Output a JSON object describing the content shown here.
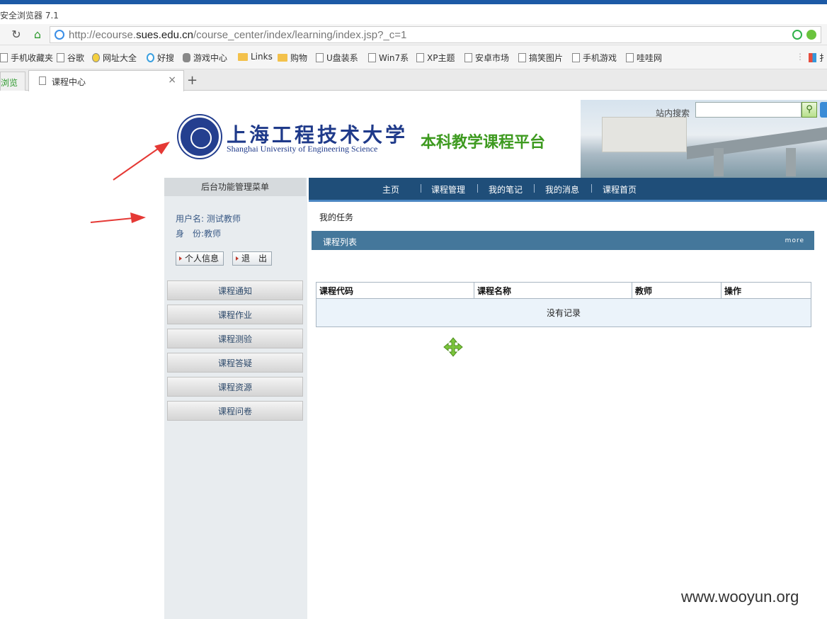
{
  "browser": {
    "window_title": "安全浏览器 7.1",
    "url_prefix": "http://ecourse.",
    "url_domain": "sues.edu.cn",
    "url_path": "/course_center/index/learning/index.jsp?_c=1",
    "bookmarks": [
      "手机收藏夹",
      "谷歌",
      "网址大全",
      "好搜",
      "游戏中心",
      "Links",
      "购物",
      "U盘装系",
      "Win7系",
      "XP主题",
      "安卓市场",
      "搞笑图片",
      "手机游戏",
      "哇哇网"
    ],
    "bookmark_overflow": "扌",
    "tab_left": "浏览",
    "tab_active": "课程中心",
    "tab_close": "×",
    "tab_new": "+"
  },
  "header": {
    "university_cn": "上海工程技术大学",
    "university_en": "Shanghai University of Engineering Science",
    "platform": "本科教学课程平台",
    "search_label": "站内搜索",
    "search_value": ""
  },
  "sidebar": {
    "title": "后台功能管理菜单",
    "username_label": "用户名:",
    "username": "测试教师",
    "role_label": "身　份:",
    "role": "教师",
    "btn_profile": "个人信息",
    "btn_logout": "退　出",
    "menu": [
      "课程通知",
      "课程作业",
      "课程测验",
      "课程答疑",
      "课程资源",
      "课程问卷"
    ]
  },
  "topnav": [
    "主页",
    "课程管理",
    "我的笔记",
    "我的消息",
    "课程首页"
  ],
  "main": {
    "my_tasks": "我的任务",
    "list_title": "课程列表",
    "more": "more",
    "columns": [
      "课程代码",
      "课程名称",
      "教师",
      "操作"
    ],
    "empty": "没有记录"
  },
  "watermark": "www.wooyun.org",
  "colors": {
    "nav_bg": "#1f4e79",
    "list_bar": "#44779b",
    "platform_green": "#3d9a1f",
    "arrow_red": "#e53935"
  }
}
